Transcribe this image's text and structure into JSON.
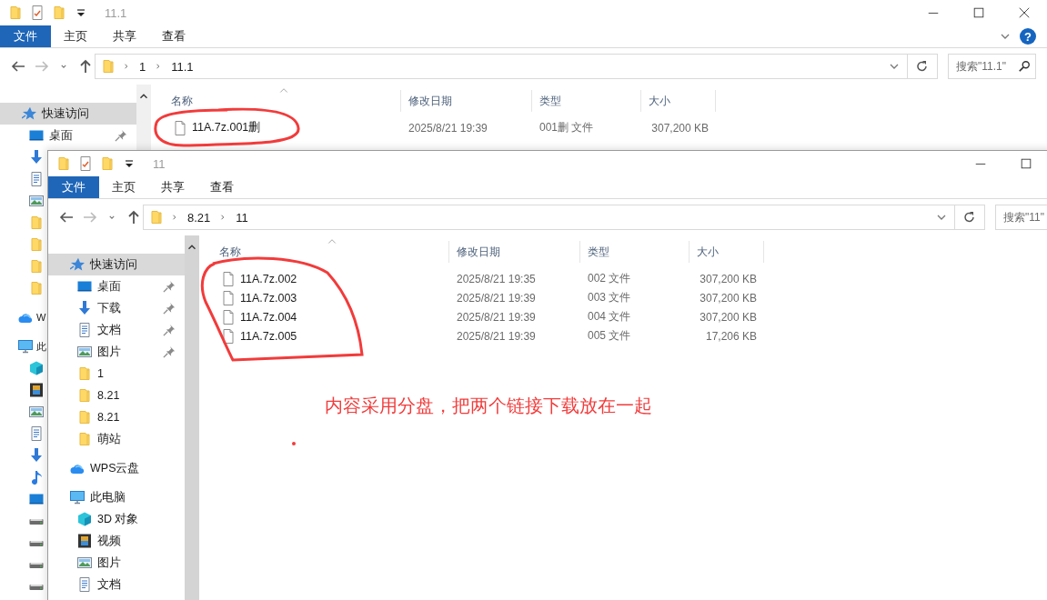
{
  "windows": [
    {
      "title": "11.1",
      "help": "?",
      "tabs": [
        {
          "label": "文件",
          "kind": "menu"
        },
        {
          "label": "主页",
          "kind": "tab"
        },
        {
          "label": "共享",
          "kind": "tab"
        },
        {
          "label": "查看",
          "kind": "tab"
        }
      ],
      "path": [
        "1",
        "11.1"
      ],
      "search": {
        "placeholder": "搜索\"11.1\""
      },
      "nav": [
        {
          "label": "快速访问",
          "kind": "star",
          "selected": true,
          "children": [
            {
              "label": "桌面",
              "kind": "desktop",
              "pinned": true,
              "selected": false
            },
            {
              "kind": "download",
              "selected": false
            },
            {
              "kind": "doc",
              "selected": false
            },
            {
              "kind": "picture",
              "selected": false
            },
            {
              "kind": "folder",
              "selected": false
            },
            {
              "kind": "folder",
              "selected": false
            },
            {
              "kind": "folder",
              "selected": false
            },
            {
              "kind": "folder",
              "selected": false
            }
          ]
        },
        {
          "label": "W",
          "kind": "cloud",
          "selected": false
        },
        {
          "label": "此",
          "kind": "pc",
          "selected": false,
          "children": [
            {
              "kind": "cube",
              "selected": false
            },
            {
              "kind": "video",
              "selected": false
            },
            {
              "kind": "picture",
              "selected": false
            },
            {
              "kind": "doc",
              "selected": false
            },
            {
              "kind": "download",
              "selected": false
            },
            {
              "kind": "music",
              "selected": false
            },
            {
              "kind": "desktop",
              "selected": false
            },
            {
              "kind": "drive",
              "selected": false
            },
            {
              "kind": "drive",
              "selected": false
            },
            {
              "kind": "drive",
              "selected": false
            },
            {
              "kind": "drive",
              "selected": false
            }
          ]
        }
      ],
      "columns": [
        "名称",
        "修改日期",
        "类型",
        "大小"
      ],
      "files": [
        {
          "name": "11A.7z.001删",
          "modified": "2025/8/21 19:39",
          "type": "001删 文件",
          "size": "307,200 KB"
        }
      ]
    },
    {
      "title": "11",
      "tabs": [
        {
          "label": "文件",
          "kind": "menu"
        },
        {
          "label": "主页",
          "kind": "tab"
        },
        {
          "label": "共享",
          "kind": "tab"
        },
        {
          "label": "查看",
          "kind": "tab"
        }
      ],
      "path": [
        "8.21",
        "11"
      ],
      "search": {
        "placeholder": "搜索\"11\""
      },
      "nav": [
        {
          "label": "快速访问",
          "kind": "star",
          "selected": true,
          "children": [
            {
              "label": "桌面",
              "kind": "desktop",
              "pinned": true,
              "selected": false
            },
            {
              "label": "下载",
              "kind": "download",
              "pinned": true,
              "selected": false
            },
            {
              "label": "文档",
              "kind": "doc",
              "pinned": true,
              "selected": false
            },
            {
              "label": "图片",
              "kind": "picture",
              "pinned": true,
              "selected": false
            },
            {
              "label": "1",
              "kind": "folder",
              "pinned": false,
              "selected": false
            },
            {
              "label": "8.21",
              "kind": "folder",
              "pinned": false,
              "selected": false
            },
            {
              "label": "8.21",
              "kind": "folder",
              "pinned": false,
              "selected": false
            },
            {
              "label": "萌站",
              "kind": "folder",
              "pinned": false,
              "selected": false
            }
          ]
        },
        {
          "label": "WPS云盘",
          "kind": "cloud",
          "selected": false
        },
        {
          "label": "此电脑",
          "kind": "pc",
          "selected": false,
          "children": [
            {
              "label": "3D 对象",
              "kind": "cube",
              "selected": false
            },
            {
              "label": "视频",
              "kind": "video",
              "selected": false
            },
            {
              "label": "图片",
              "kind": "picture",
              "selected": false
            },
            {
              "label": "文档",
              "kind": "doc",
              "selected": false
            }
          ]
        }
      ],
      "columns": [
        "名称",
        "修改日期",
        "类型",
        "大小"
      ],
      "files": [
        {
          "name": "11A.7z.002",
          "modified": "2025/8/21 19:35",
          "type": "002 文件",
          "size": "307,200 KB"
        },
        {
          "name": "11A.7z.003",
          "modified": "2025/8/21 19:39",
          "type": "003 文件",
          "size": "307,200 KB"
        },
        {
          "name": "11A.7z.004",
          "modified": "2025/8/21 19:39",
          "type": "004 文件",
          "size": "307,200 KB"
        },
        {
          "name": "11A.7z.005",
          "modified": "2025/8/21 19:39",
          "type": "005 文件",
          "size": "17,206 KB"
        }
      ]
    }
  ],
  "annotation": {
    "note": "内容采用分盘，把两个链接下载放在一起"
  }
}
